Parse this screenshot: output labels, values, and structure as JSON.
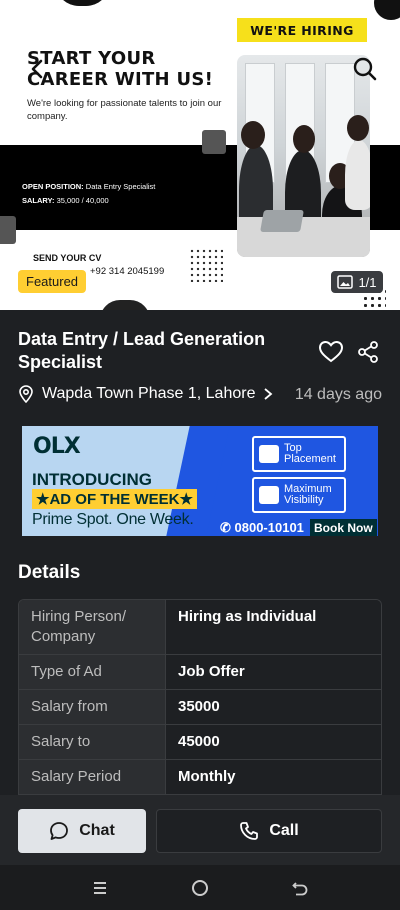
{
  "hero": {
    "headline_line1": "START YOUR",
    "headline_line2": "CAREER WITH US!",
    "subtext": "We're looking for passionate talents to join our company.",
    "position_label": "OPEN POSITION:",
    "position_value": "Data Entry Specialist",
    "salary_label": "SALARY:",
    "salary_value": "35,000 / 40,000",
    "send_cv": "SEND YOUR CV",
    "phone": "+92 314 2045199",
    "hiring_badge": "WE'RE HIRING",
    "featured_label": "Featured",
    "image_counter": "1/1"
  },
  "listing": {
    "title": "Data Entry / Lead Generation Specialist",
    "location": "Wapda Town Phase 1, Lahore",
    "posted": "14 days ago"
  },
  "banner": {
    "logo": "OLX",
    "line1": "INTRODUCING",
    "line2": "★AD OF THE WEEK★",
    "line3": "Prime Spot. One Week.",
    "box1": "Top Placement",
    "box2": "Maximum Visibility",
    "phone": "0800-10101",
    "cta": "Book Now"
  },
  "details": {
    "heading": "Details",
    "rows": [
      {
        "key": "Hiring Person/ Company",
        "value": "Hiring as Individual"
      },
      {
        "key": "Type of Ad",
        "value": "Job Offer"
      },
      {
        "key": "Salary from",
        "value": "35000"
      },
      {
        "key": "Salary to",
        "value": "45000"
      },
      {
        "key": "Salary Period",
        "value": "Monthly"
      }
    ]
  },
  "actions": {
    "chat": "Chat",
    "call": "Call"
  },
  "icons": {
    "back": "chevron-left-icon",
    "search": "search-icon",
    "favorite": "heart-icon",
    "share": "share-icon",
    "location": "location-pin-icon",
    "gallery": "image-icon"
  },
  "colors": {
    "background": "#1e2023",
    "featured": "#ffce32",
    "banner_blue": "#1f56e1"
  }
}
